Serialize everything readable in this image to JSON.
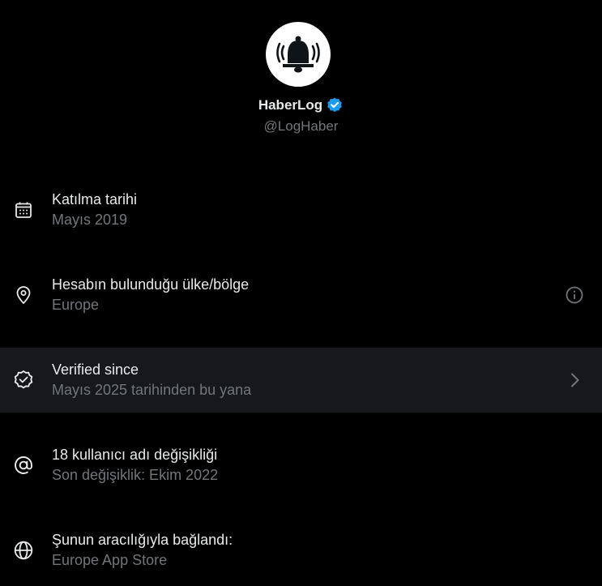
{
  "profile": {
    "display_name": "HaberLog",
    "handle": "@LogHaber",
    "avatar_icon": "bell-icon",
    "verified": true,
    "verified_color": "#1d9bf0"
  },
  "rows": [
    {
      "icon": "calendar-icon",
      "title": "Katılma tarihi",
      "subtitle": "Mayıs 2019",
      "trailing": null
    },
    {
      "icon": "location-pin-icon",
      "title": "Hesabın bulunduğu ülke/bölge",
      "subtitle": "Europe",
      "trailing": "info-icon"
    },
    {
      "icon": "verified-badge-icon",
      "title": "Verified since",
      "subtitle": "Mayıs 2025 tarihinden bu yana",
      "trailing": "chevron-right-icon"
    },
    {
      "icon": "at-sign-icon",
      "title": "18 kullanıcı adı değişikliği",
      "subtitle": "Son değişiklik: Ekim 2022",
      "trailing": null
    },
    {
      "icon": "globe-icon",
      "title": "Şunun aracılığıyla bağlandı:",
      "subtitle": "Europe App Store",
      "trailing": null
    }
  ],
  "colors": {
    "background": "#000000",
    "highlight_row": "#16181c",
    "primary_text": "#e7e9ea",
    "secondary_text": "#71767b",
    "accent": "#1d9bf0"
  }
}
